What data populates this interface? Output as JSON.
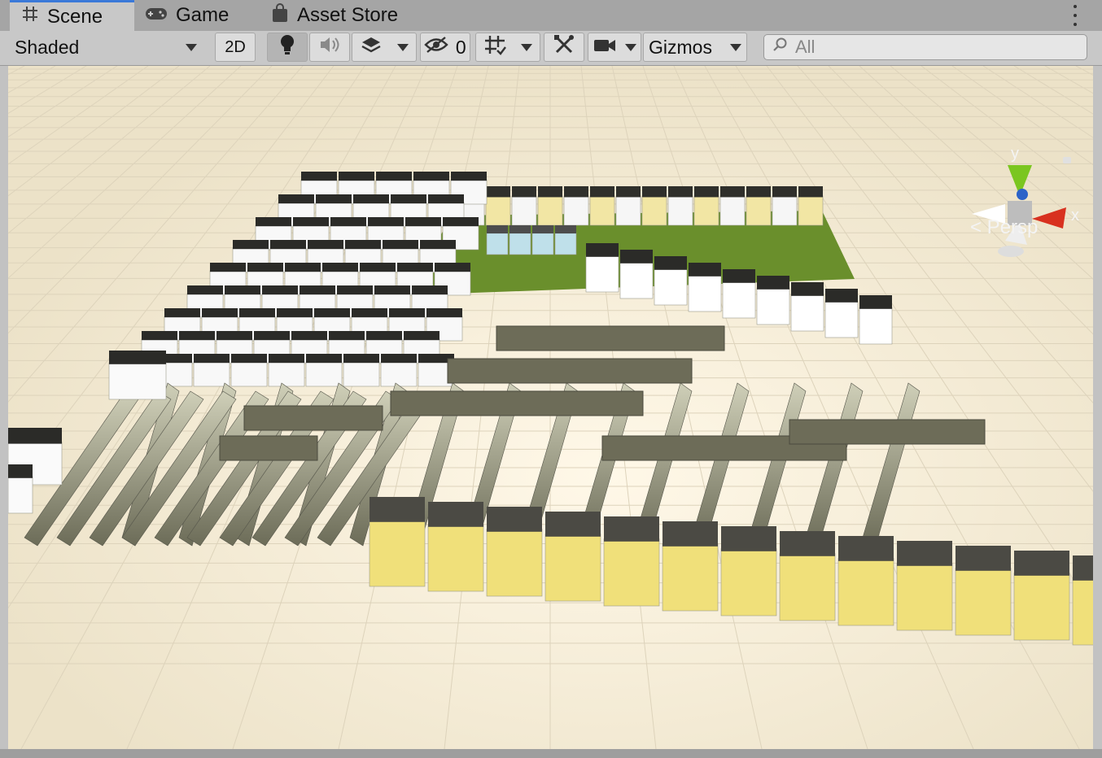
{
  "tabs": [
    {
      "label": "Scene",
      "icon": "grid-hash-icon",
      "active": true
    },
    {
      "label": "Game",
      "icon": "gamepad-icon",
      "active": false
    },
    {
      "label": "Asset Store",
      "icon": "shopping-bag-icon",
      "active": false
    }
  ],
  "toolbar": {
    "draw_mode": "Shaded",
    "mode_2d": "2D",
    "hidden_count": "0",
    "gizmos": "Gizmos",
    "search_placeholder": "All"
  },
  "scene_gizmo": {
    "y_label": "y",
    "x_label": "x",
    "projection_label": "< Persp"
  },
  "colors": {
    "active_tab_accent": "#3a79d8",
    "ground": "#efe7d2",
    "grass": "#6a8f2c",
    "x_axis": "#d8311f",
    "y_axis": "#7bc620",
    "z_axis": "#2c63c8"
  }
}
